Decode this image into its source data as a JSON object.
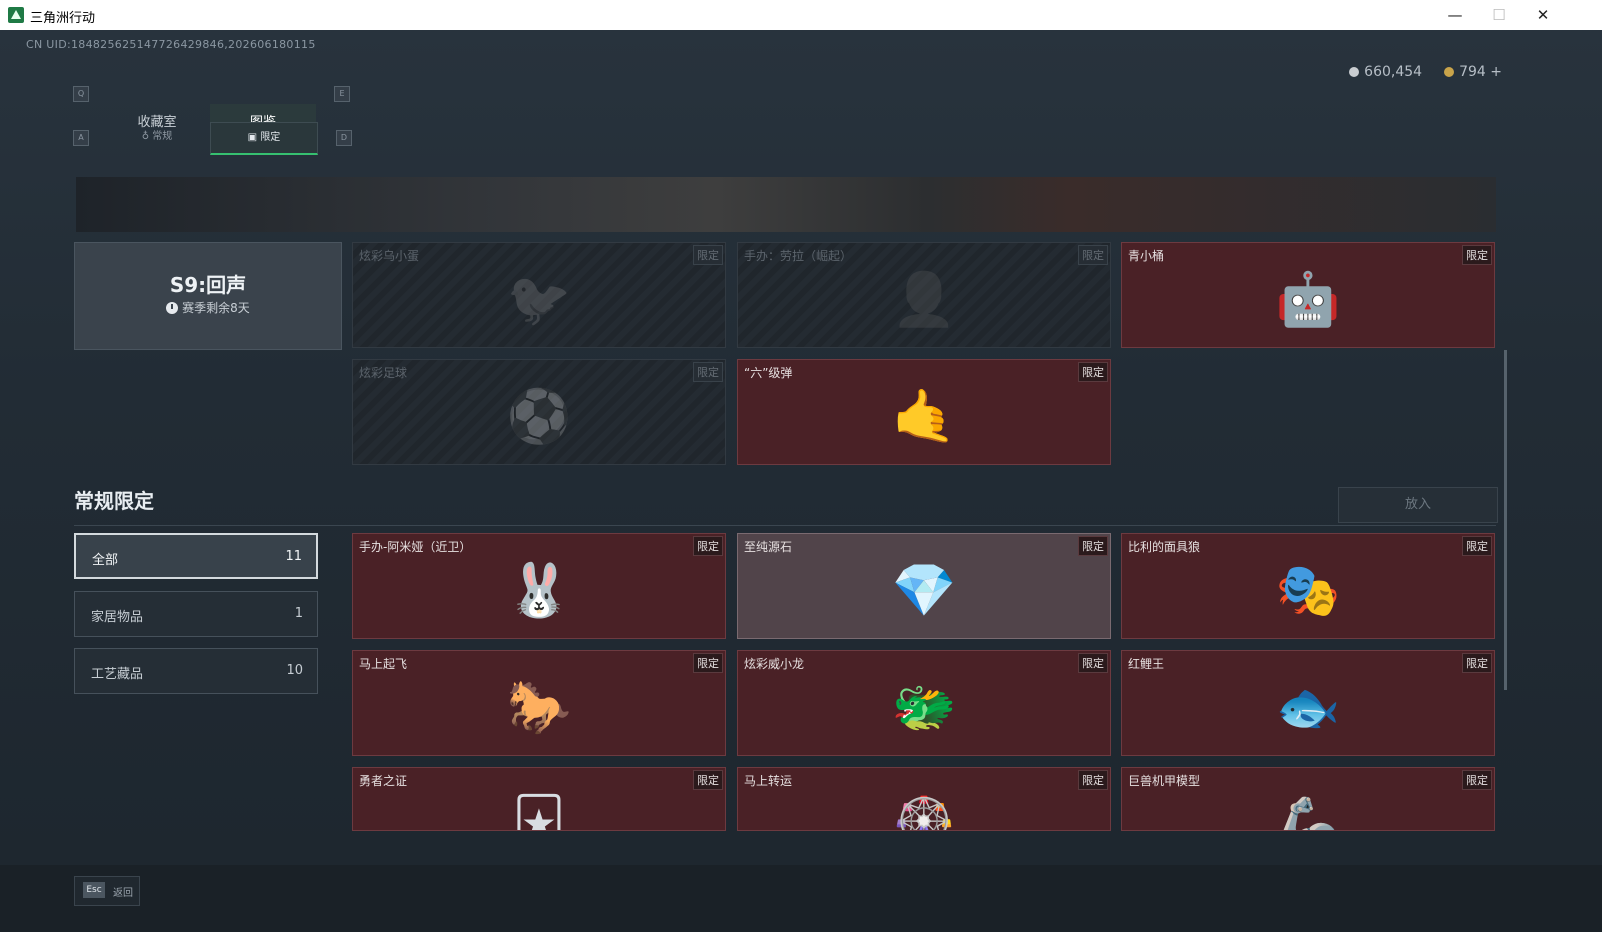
{
  "window": {
    "title": "三角洲行动",
    "minimize": "—",
    "maximize": "☐",
    "close": "✕"
  },
  "header": {
    "uid": "CN UID:18482562514772642984​6,202606180115",
    "currency": [
      {
        "icon": "silver-coin-icon",
        "value": "660,454",
        "color": "#c9cdd1"
      },
      {
        "icon": "gold-coin-icon",
        "value": "794",
        "color": "#c9a44a"
      }
    ],
    "add_symbol": "+"
  },
  "tabs": {
    "key_left": "Q",
    "key_right": "E",
    "items": [
      {
        "label": "收藏室"
      },
      {
        "label": "图鉴"
      }
    ]
  },
  "subtabs": {
    "key_left": "A",
    "key_right": "D",
    "items": [
      {
        "label": "常规"
      },
      {
        "label": "限定"
      }
    ]
  },
  "season": {
    "name": "S9:回声",
    "remaining": "赛季剩余8天"
  },
  "season_cards": [
    {
      "name": "炫彩乌小蛋",
      "badge": "限定"
    },
    {
      "name": "手办：劳拉（崛起）",
      "badge": "限定"
    },
    {
      "name": "青小桶",
      "badge": "限定"
    },
    {
      "name": "炫彩足球",
      "badge": "限定"
    },
    {
      "name": "“六”级弹",
      "badge": "限定"
    }
  ],
  "section": {
    "title": "常规限定",
    "put_button": "放入"
  },
  "filters": [
    {
      "label": "全部",
      "count": "11"
    },
    {
      "label": "家居物品",
      "count": "1"
    },
    {
      "label": "工艺藏品",
      "count": "10"
    }
  ],
  "items": [
    {
      "name": "手办-阿米娅（近卫）",
      "badge": "限定"
    },
    {
      "name": "至纯源石",
      "badge": "限定"
    },
    {
      "name": "比利的面具狼",
      "badge": "限定"
    },
    {
      "name": "马上起飞",
      "badge": "限定"
    },
    {
      "name": "炫彩威小龙",
      "badge": "限定"
    },
    {
      "name": "红鲤王",
      "badge": "限定"
    },
    {
      "name": "勇者之证",
      "badge": "限定"
    },
    {
      "name": "马上转运",
      "badge": "限定"
    },
    {
      "name": "巨兽机甲模型",
      "badge": "限定"
    }
  ],
  "footer": {
    "key": "Esc",
    "label": "返回"
  }
}
